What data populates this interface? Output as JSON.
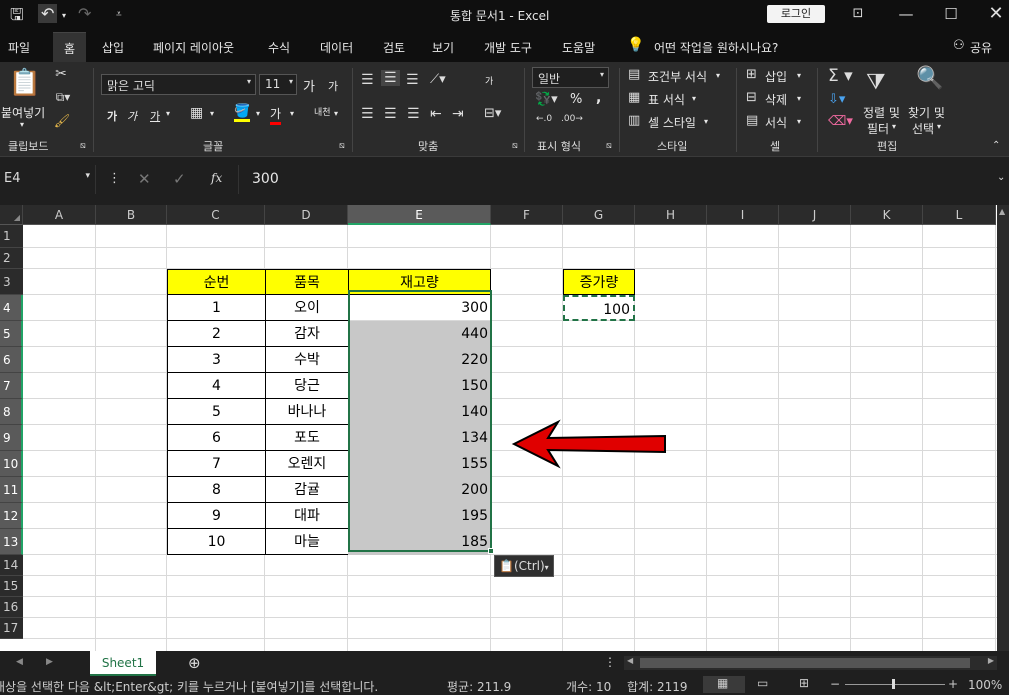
{
  "titlebar": {
    "title": "통합 문서1 - Excel",
    "login": "로그인",
    "undo": "↶",
    "redo": "↷"
  },
  "tabs": [
    "파일",
    "홈",
    "삽입",
    "페이지 레이아웃",
    "수식",
    "데이터",
    "검토",
    "보기",
    "개발 도구",
    "도움말"
  ],
  "tellme": "어떤 작업을 원하시나요?",
  "share": "공유",
  "ribbon": {
    "clipboard": {
      "paste": "붙여넣기",
      "label": "클립보드"
    },
    "font": {
      "name": "맑은 고딕",
      "size": "11",
      "grow": "가",
      "shrink": "가",
      "bold": "가",
      "italic": "가",
      "underline": "가",
      "color": "가",
      "phonetic": "내천",
      "label": "글꼴"
    },
    "align": {
      "label": "맞춤",
      "orient": "가"
    },
    "number": {
      "format": "일반",
      "pct": "%",
      "comma": ",",
      "label": "표시 형식"
    },
    "styles": {
      "cond": "조건부 서식",
      "table": "표 서식",
      "cell": "셀 스타일",
      "label": "스타일"
    },
    "cells": {
      "insert": "삽입",
      "delete": "삭제",
      "format": "서식",
      "label": "셀"
    },
    "edit": {
      "sort1": "정렬 및",
      "sort2": "필터",
      "find1": "찾기 및",
      "find2": "선택",
      "label": "편집"
    }
  },
  "formula": {
    "namebox": "E4",
    "value": "300",
    "fx": "fx"
  },
  "columns": [
    "A",
    "B",
    "C",
    "D",
    "E",
    "F",
    "G",
    "H",
    "I",
    "J",
    "K",
    "L"
  ],
  "rows": [
    "1",
    "2",
    "3",
    "4",
    "5",
    "6",
    "7",
    "8",
    "9",
    "10",
    "11",
    "12",
    "13",
    "14",
    "15",
    "16",
    "17"
  ],
  "table": {
    "headers": [
      "순번",
      "품목",
      "재고량"
    ],
    "rows": [
      [
        "1",
        "오이",
        "300"
      ],
      [
        "2",
        "감자",
        "440"
      ],
      [
        "3",
        "수박",
        "220"
      ],
      [
        "4",
        "당근",
        "150"
      ],
      [
        "5",
        "바나나",
        "140"
      ],
      [
        "6",
        "포도",
        "134"
      ],
      [
        "7",
        "오렌지",
        "155"
      ],
      [
        "8",
        "감귤",
        "200"
      ],
      [
        "9",
        "대파",
        "195"
      ],
      [
        "10",
        "마늘",
        "185"
      ]
    ]
  },
  "increase": {
    "label": "증가량",
    "value": "100"
  },
  "paste_options": "(Ctrl)",
  "sheet": {
    "name": "Sheet1"
  },
  "status": {
    "msg": "대상을 선택한 다음 &lt;Enter&gt; 키를 누르거나 [붙여넣기]를 선택합니다.",
    "avg": "평균: 211.9",
    "count": "개수: 10",
    "sum": "합계: 2119",
    "zoom": "100%"
  },
  "colors": {
    "accent": "#21a366",
    "header_fill": "#ffff00",
    "selection_fill": "#c8c8c8",
    "arrow": "#e00000"
  }
}
